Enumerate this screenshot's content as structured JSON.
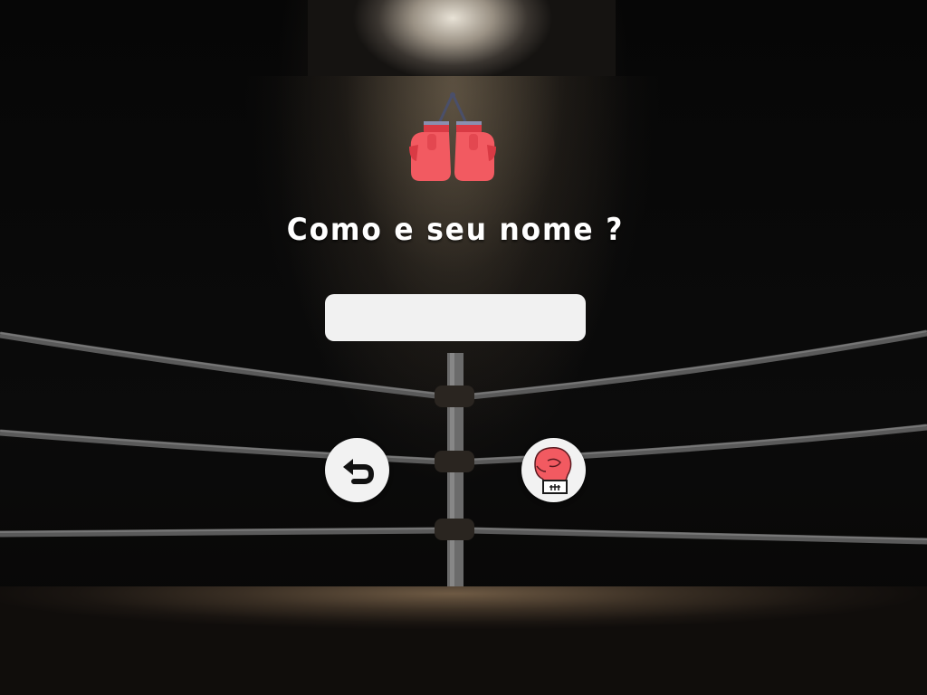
{
  "screen": {
    "title": "Como e seu nome ?"
  },
  "name_input": {
    "value": "",
    "placeholder": ""
  },
  "icons": {
    "logo": "hanging-boxing-gloves-icon",
    "back": "undo-arrow-icon",
    "confirm": "boxing-glove-icon"
  },
  "colors": {
    "glove_red": "#f25a61",
    "glove_dark": "#d93a44",
    "input_bg": "#f1f1f1",
    "button_bg": "#f2f2f2",
    "text": "#ffffff"
  }
}
